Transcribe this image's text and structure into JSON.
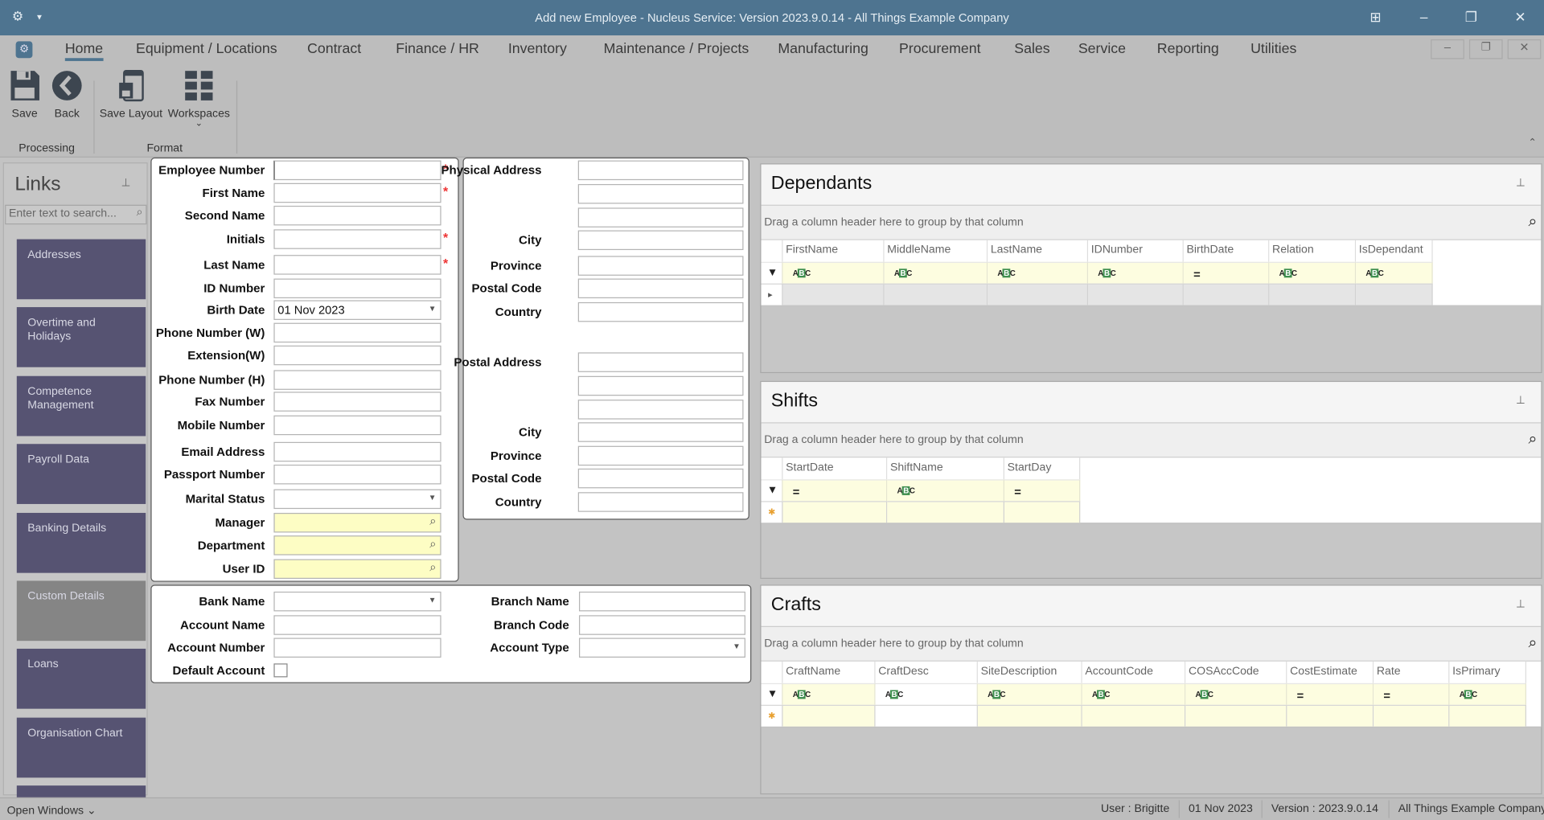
{
  "window": {
    "title": "Add new Employee - Nucleus Service: Version 2023.9.0.14 - All Things Example Company"
  },
  "menu": {
    "tabs": [
      "Home",
      "Equipment / Locations",
      "Contract",
      "Finance / HR",
      "Inventory",
      "Maintenance / Projects",
      "Manufacturing",
      "Procurement",
      "Sales",
      "Service",
      "Reporting",
      "Utilities"
    ],
    "active": "Home"
  },
  "ribbon": {
    "save": "Save",
    "back": "Back",
    "save_layout": "Save Layout",
    "workspaces": "Workspaces",
    "group_processing": "Processing",
    "group_format": "Format"
  },
  "links": {
    "title": "Links",
    "search_placeholder": "Enter text to search...",
    "items": [
      "Addresses",
      "Overtime and Holidays",
      "Competence Management",
      "Payroll Data",
      "Banking Details",
      "Custom Details",
      "Loans",
      "Organisation Chart",
      ""
    ],
    "selected": "Custom Details"
  },
  "employee_form": {
    "fields": [
      {
        "label": "Employee Number",
        "value": "",
        "required": true
      },
      {
        "label": "First Name",
        "value": "",
        "required": true
      },
      {
        "label": "Second Name",
        "value": ""
      },
      {
        "label": "Initials",
        "value": "",
        "required": true
      },
      {
        "label": "Last Name",
        "value": "",
        "required": true
      },
      {
        "label": "ID Number",
        "value": ""
      },
      {
        "label": "Birth Date",
        "value": "01 Nov 2023",
        "type": "dropdown"
      },
      {
        "label": "Phone Number (W)",
        "value": ""
      },
      {
        "label": "Extension(W)",
        "value": ""
      },
      {
        "label": "Phone Number (H)",
        "value": ""
      },
      {
        "label": "Fax Number",
        "value": ""
      },
      {
        "label": "Mobile Number",
        "value": ""
      },
      {
        "label": "Email Address",
        "value": ""
      },
      {
        "label": "Passport Number",
        "value": ""
      },
      {
        "label": "Marital Status",
        "value": "",
        "type": "dropdown"
      },
      {
        "label": "Manager",
        "value": "",
        "type": "lookup"
      },
      {
        "label": "Department",
        "value": "",
        "type": "lookup"
      },
      {
        "label": "User ID",
        "value": "",
        "type": "lookup"
      }
    ],
    "required_mark": "*"
  },
  "address_form": {
    "fields": [
      {
        "label": "Physical Address",
        "value": ""
      },
      {
        "label": "",
        "value": ""
      },
      {
        "label": "",
        "value": ""
      },
      {
        "label": "City",
        "value": ""
      },
      {
        "label": "Province",
        "value": ""
      },
      {
        "label": "Postal Code",
        "value": ""
      },
      {
        "label": "Country",
        "value": ""
      },
      {
        "label": "Postal Address",
        "value": ""
      },
      {
        "label": "",
        "value": ""
      },
      {
        "label": "",
        "value": ""
      },
      {
        "label": "City",
        "value": ""
      },
      {
        "label": "Province",
        "value": ""
      },
      {
        "label": "Postal Code",
        "value": ""
      },
      {
        "label": "Country",
        "value": ""
      }
    ]
  },
  "bank_form": {
    "left": [
      {
        "label": "Bank Name",
        "value": "",
        "type": "dropdown"
      },
      {
        "label": "Account Name",
        "value": ""
      },
      {
        "label": "Account Number",
        "value": ""
      },
      {
        "label": "Default Account",
        "type": "checkbox",
        "checked": false
      }
    ],
    "right": [
      {
        "label": "Branch Name",
        "value": ""
      },
      {
        "label": "Branch Code",
        "value": ""
      },
      {
        "label": "Account Type",
        "value": "",
        "type": "dropdown"
      }
    ]
  },
  "grids": [
    {
      "title": "Dependants",
      "group_hint": "Drag a column header here to group by that column",
      "columns": [
        {
          "name": "FirstName",
          "filter": "text"
        },
        {
          "name": "MiddleName",
          "filter": "text"
        },
        {
          "name": "LastName",
          "filter": "text"
        },
        {
          "name": "IDNumber",
          "filter": "text"
        },
        {
          "name": "BirthDate",
          "filter": "equals"
        },
        {
          "name": "Relation",
          "filter": "text"
        },
        {
          "name": "IsDependant",
          "filter": "text"
        }
      ],
      "new_row": "arrow"
    },
    {
      "title": "Shifts",
      "group_hint": "Drag a column header here to group by that column",
      "columns": [
        {
          "name": "StartDate",
          "filter": "equals"
        },
        {
          "name": "ShiftName",
          "filter": "text"
        },
        {
          "name": "StartDay",
          "filter": "equals"
        }
      ],
      "new_row": "asterisk"
    },
    {
      "title": "Crafts",
      "group_hint": "Drag a column header here to group by that column",
      "columns": [
        {
          "name": "CraftName",
          "filter": "text"
        },
        {
          "name": "CraftDesc",
          "filter": "text"
        },
        {
          "name": "SiteDescription",
          "filter": "text"
        },
        {
          "name": "AccountCode",
          "filter": "text"
        },
        {
          "name": "COSAccCode",
          "filter": "text"
        },
        {
          "name": "CostEstimate",
          "filter": "equals"
        },
        {
          "name": "Rate",
          "filter": "equals"
        },
        {
          "name": "IsPrimary",
          "filter": "text"
        }
      ],
      "new_row": "asterisk"
    }
  ],
  "statusbar": {
    "open_windows": "Open Windows",
    "user": "User : Brigitte",
    "date": "01 Nov 2023",
    "version": "Version : 2023.9.0.14",
    "company": "All Things Example Company"
  },
  "colors": {
    "titlebar": "#4e7490",
    "link_tile": "#565372",
    "link_tile_selected": "#858585",
    "lookup_field": "#fdfdc4",
    "required": "#ee3333"
  }
}
